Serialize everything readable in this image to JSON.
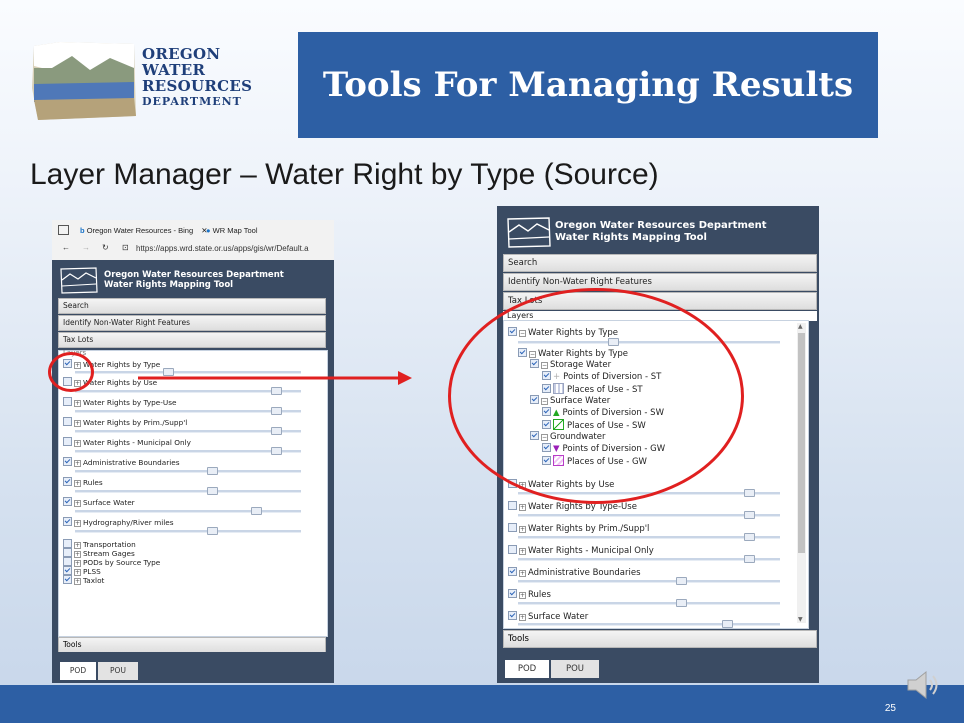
{
  "slide": {
    "logo_line1": "OREGON",
    "logo_line2": "WATER",
    "logo_line3": "RESOURCES",
    "logo_line4": "DEPARTMENT",
    "title": "Tools For Managing Results",
    "subtitle": "Layer Manager – Water Right by Type (Source)",
    "page_number": "25"
  },
  "browser": {
    "tab1": "Oregon Water Resources - Bing",
    "tab2": "WR Map Tool",
    "url": "https://apps.wrd.state.or.us/apps/gis/wr/Default.a"
  },
  "panel": {
    "title_line1": "Oregon Water Resources Department",
    "title_line2": "Water Rights Mapping Tool",
    "menu": [
      "Search",
      "Identify Non-Water Right Features",
      "Tax Lots",
      "Layers"
    ],
    "tools": "Tools",
    "tabs": [
      "POD",
      "POU"
    ]
  },
  "left_layers": [
    "Water Rights by Type",
    "Water Rights by Use",
    "Water Rights by Type-Use",
    "Water Rights by Prim./Supp'l",
    "Water Rights - Municipal Only",
    "Administrative Boundaries",
    "Rules",
    "Surface Water",
    "Hydrography/River miles",
    "Transportation",
    "Stream Gages",
    "PODs by Source Type",
    "PLSS",
    "Taxlot"
  ],
  "right_tree": {
    "root": "Water Rights by Type",
    "child": "Water Rights by Type",
    "groups": [
      {
        "name": "Storage Water",
        "pod": "Points of Diversion - ST",
        "pou": "Places of Use - ST"
      },
      {
        "name": "Surface Water",
        "pod": "Points of Diversion - SW",
        "pou": "Places of Use - SW"
      },
      {
        "name": "Groundwater",
        "pod": "Points of Diversion - GW",
        "pou": "Places of Use - GW"
      }
    ],
    "rest": [
      "Water Rights by Use",
      "Water Rights by Type-Use",
      "Water Rights by Prim./Supp'l",
      "Water Rights - Municipal Only",
      "Administrative Boundaries",
      "Rules",
      "Surface Water"
    ]
  },
  "colors": {
    "title_bg": "#2d5fa4",
    "panel_bg": "#3a4b63",
    "annotation": "#e02020"
  }
}
